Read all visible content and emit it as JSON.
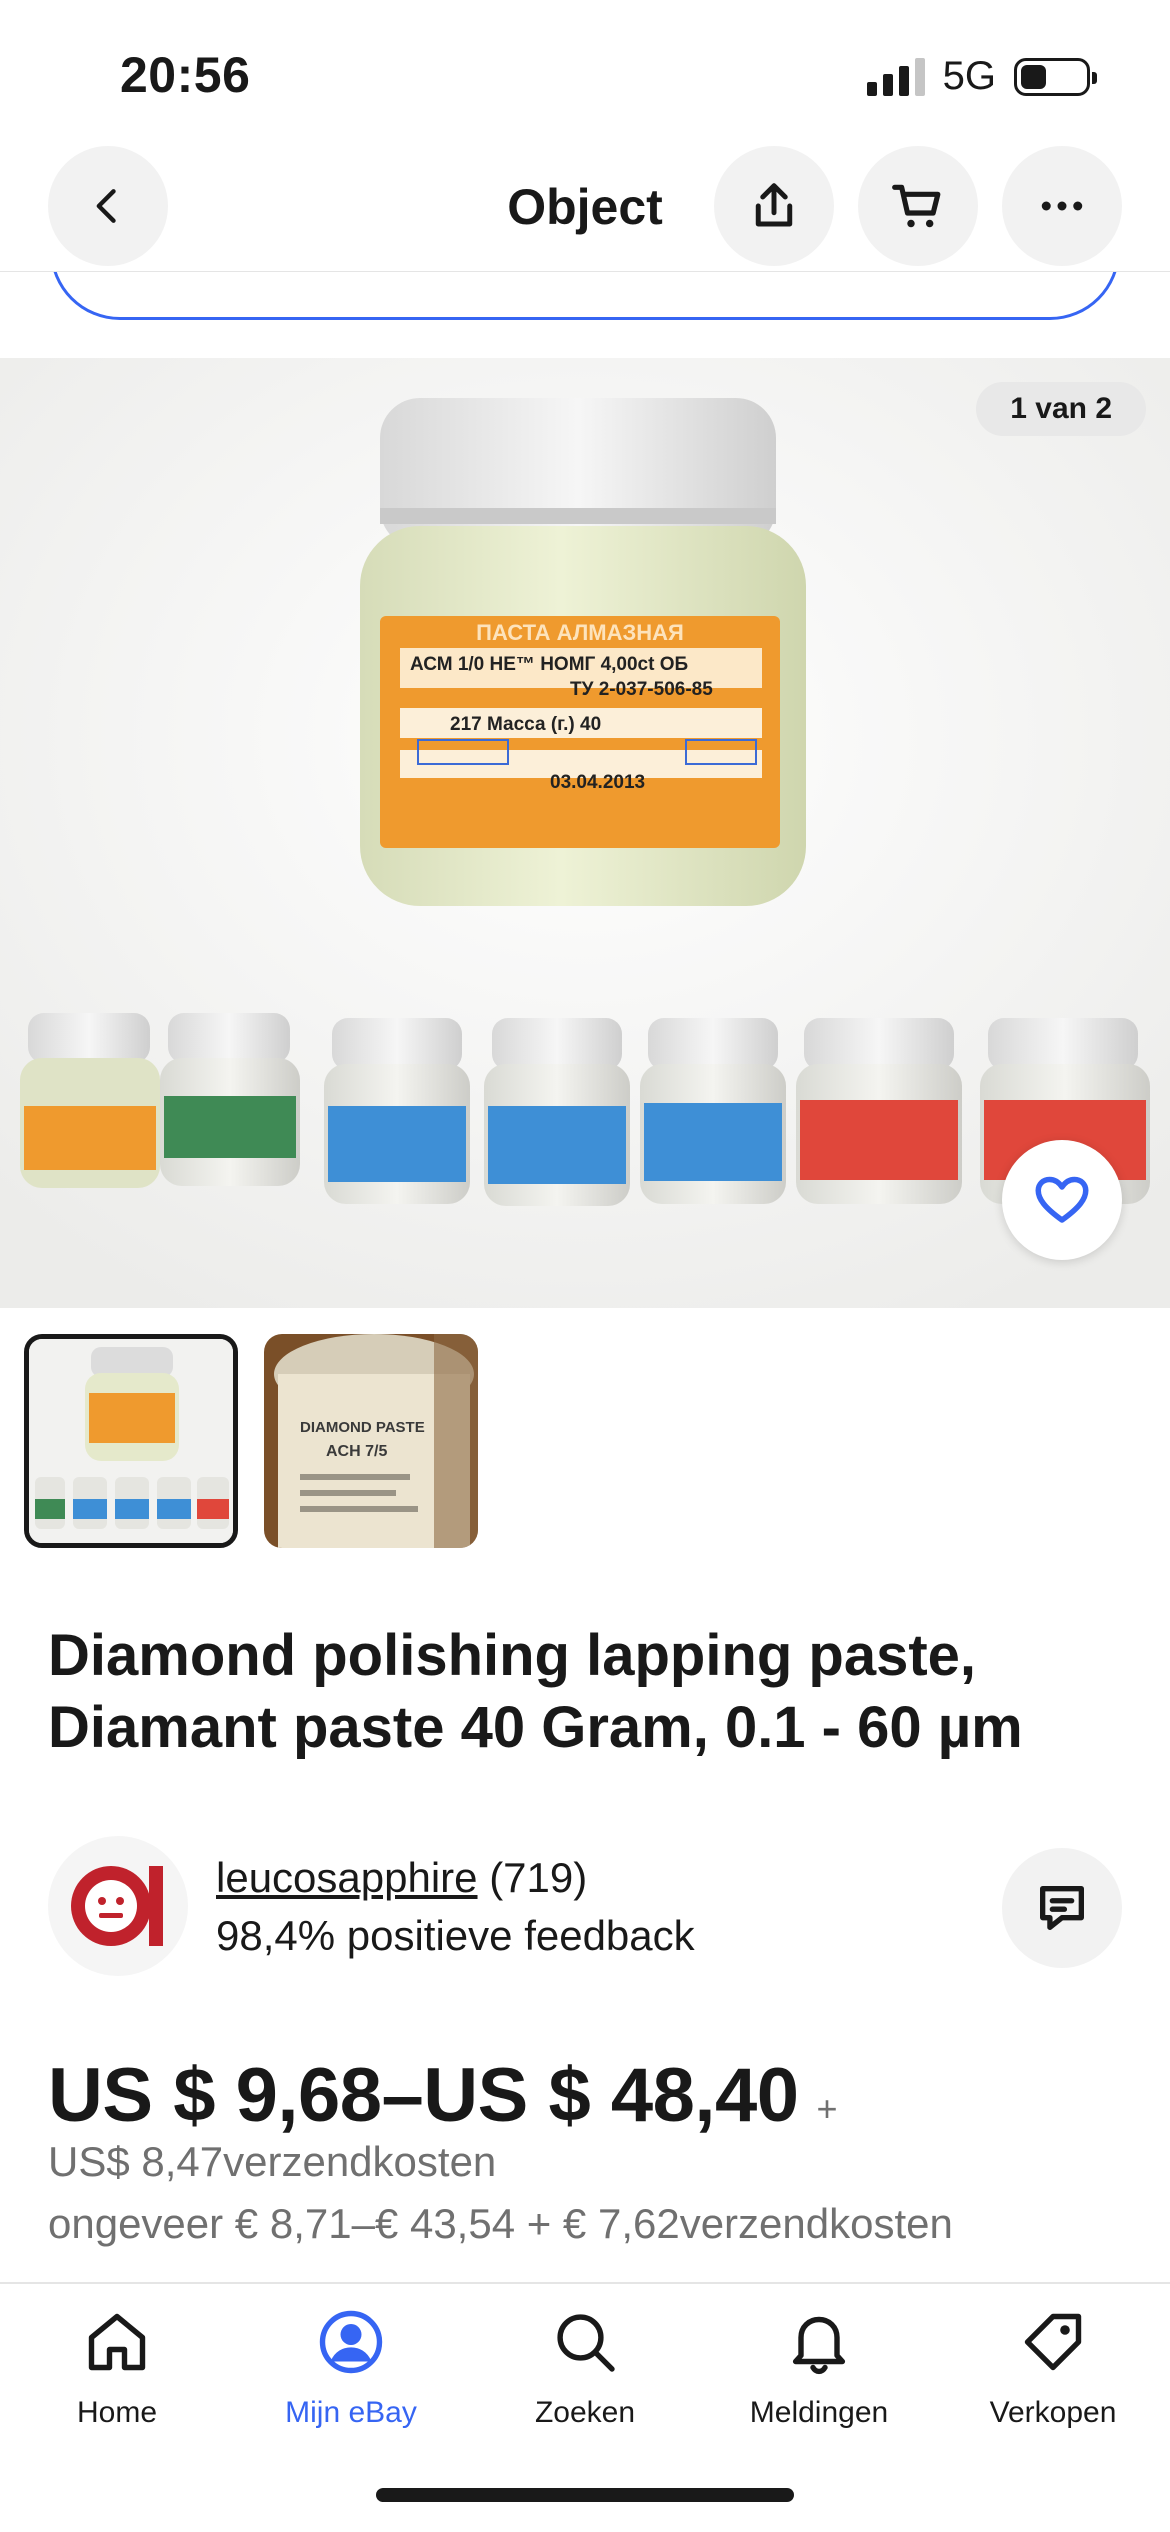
{
  "status_bar": {
    "time": "20:56",
    "network": "5G",
    "signal_bars": 3,
    "battery_level": 0.4
  },
  "nav": {
    "title": "Object",
    "back_icon": "chevron-left-icon",
    "share_icon": "share-icon",
    "cart_icon": "cart-icon",
    "more_icon": "more-horizontal-icon"
  },
  "gallery": {
    "counter": "1 van 2",
    "favorite_icon": "heart-icon"
  },
  "thumbnails": [
    {
      "name": "thumbnail-1",
      "active": true
    },
    {
      "name": "thumbnail-2",
      "active": false
    }
  ],
  "listing": {
    "title": "Diamond polishing lapping paste, Diamant paste 40 Gram, 0.1 - 60 µm"
  },
  "jar_label": {
    "line1": "ПАСТА АЛМАЗНАЯ",
    "line2": "АСМ 1/0 НЕ™ НОМГ 4,00ct ОБ",
    "line3": "ТУ 2-037-506-85",
    "line4": "217 Масса (г.) 40",
    "line5": "03.04.2013",
    "thumb2_line1": "DIAMOND PASTE",
    "thumb2_line2": "ACH 7/5"
  },
  "seller": {
    "name": "leucosapphire",
    "count": "(719)",
    "feedback": "98,4% positieve feedback",
    "message_icon": "message-icon"
  },
  "price": {
    "range": "US $ 9,68–US $ 48,40",
    "plus": "+",
    "shipping": "US$ 8,47verzendkosten",
    "approx": "ongeveer € 8,71–€ 43,54 + € 7,62verzendkosten"
  },
  "tabs": [
    {
      "label": "Home",
      "icon": "home-icon",
      "active": false
    },
    {
      "label": "Mijn eBay",
      "icon": "account-icon",
      "active": true
    },
    {
      "label": "Zoeken",
      "icon": "search-icon",
      "active": false
    },
    {
      "label": "Meldingen",
      "icon": "bell-icon",
      "active": false
    },
    {
      "label": "Verkopen",
      "icon": "tag-icon",
      "active": false
    }
  ],
  "colors": {
    "accent": "#3665f3",
    "text": "#191919",
    "muted": "#707070",
    "seller_logo": "#c0222c"
  }
}
